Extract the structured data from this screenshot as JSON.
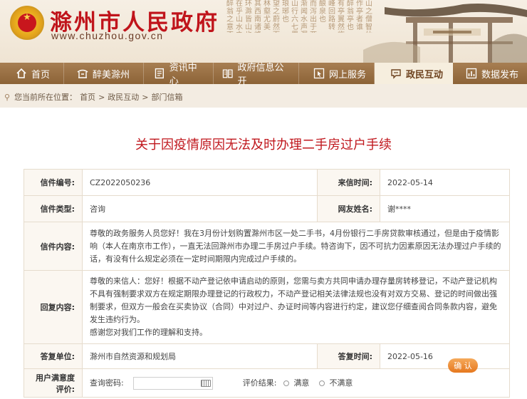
{
  "site": {
    "title": "滁州市人民政府",
    "url": "www.chuzhou.gov.cn"
  },
  "nav": {
    "items": [
      {
        "label": "首页",
        "icon": "home-icon"
      },
      {
        "label": "醉美滁州",
        "icon": "pavilion-icon"
      },
      {
        "label": "资讯中心",
        "icon": "news-icon"
      },
      {
        "label": "政府信息公开",
        "icon": "book-icon"
      },
      {
        "label": "网上服务",
        "icon": "cursor-icon"
      },
      {
        "label": "政民互动",
        "icon": "chat-icon"
      },
      {
        "label": "数据发布",
        "icon": "chart-icon"
      }
    ],
    "active_index": 5
  },
  "breadcrumb": {
    "prefix": "您当前所在位置：",
    "items": [
      "首页",
      "政民互动",
      "部门信箱"
    ],
    "separator": ">"
  },
  "letter": {
    "title": "关于因疫情原因无法及时办理二手房过户手续",
    "number_label": "信件编号:",
    "number": "CZ2022050236",
    "date_label": "来信时间:",
    "date": "2022-05-14",
    "type_label": "信件类型:",
    "type": "咨询",
    "user_label": "网友姓名:",
    "user": "谢****",
    "content_label": "信件内容:",
    "content": "尊敬的政务服务人员您好！我在3月份计划购置滁州市区一处二手书，4月份银行二手房贷款审核通过，但是由于疫情影响（本人在南京市工作），一直无法回滁州市办理二手房过户手续。特咨询下，因不可抗力因素原因无法办理过户手续的话，有没有什么规定必须在一定时间期限内完成过户手续的。",
    "reply_label": "回复内容:",
    "reply_lines": [
      "尊敬的来信人：您好！根据不动产登记依申请启动的原则，您需与卖方共同申请办理存量房转移登记，不动产登记机构不具有强制要求双方在规定期限办理登记的行政权力，不动产登记相关法律法规也没有对双方交易、登记的时间做出强制要求，但双方一般会在买卖协议（合同）中对过户、办证时间等内容进行约定，建议您仔细查阅合同条款内容，避免发生违约行为。",
      "感谢您对我们工作的理解和支持。"
    ],
    "unit_label": "答复单位:",
    "unit": "滁州市自然资源和规划局",
    "reply_date_label": "答复时间:",
    "reply_date": "2022-05-16"
  },
  "rating": {
    "label": "用户满意度评价:",
    "code_label": "查询密码:",
    "code_value": "",
    "result_label": "评价结果:",
    "options": [
      "满意",
      "不满意"
    ],
    "confirm": "确 认"
  },
  "colors": {
    "brand_red": "#c0141b",
    "nav_brown": "#9a7044",
    "confirm_orange": "#ee8b34"
  }
}
